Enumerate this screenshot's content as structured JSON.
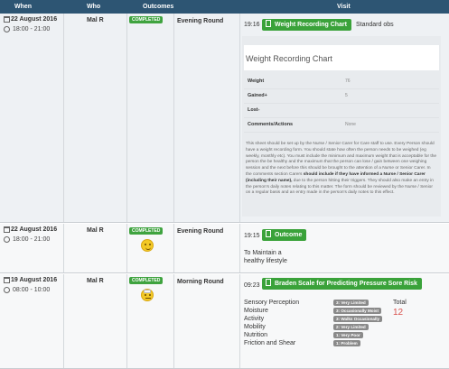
{
  "columns": {
    "when": "When",
    "who": "Who",
    "outcomes": "Outcomes",
    "visit": "Visit"
  },
  "entries": [
    {
      "date": "22 August 2016",
      "time": "18:00 - 21:00",
      "who": "Mal R",
      "status": "COMPLETED",
      "round": "Evening Round",
      "visit_time": "19:16",
      "chart_button": "Weight Recording Chart",
      "chart_note": "Standard obs",
      "sheet": {
        "title": "Weight Recording Chart",
        "rows": [
          {
            "label": "Weight",
            "value": "76"
          },
          {
            "label": "Gained+",
            "value": "5"
          },
          {
            "label": "Lost-",
            "value": ""
          },
          {
            "label": "Comments/Actions",
            "value": "None"
          }
        ],
        "note_pre": "This sheet should be set up by the Nurse / Senior Carer for Care staff to use. Every Person should have a weight recording form. You should state how often the person needs to be weighed (eg weekly, monthly etc). You must include the minimum and maximum weight that is acceptable for the person the be healthy and the maximum that the person can lose / gain between one weighing session and the next before this should be brought to the attention of a Nurse or Senior Carer. In the comments section Carers ",
        "note_bold": "should include if they have informed a Nurse / Senior Carer (including their name),",
        "note_post": " due to the person hitting their triggers. They should also make an entry in the person's daily notes relating to this matter. The form should be reviewed by the Nurse / Senior on a regular basis and an entry made in the person's daily notes to this effect."
      }
    },
    {
      "date": "22 August 2016",
      "time": "18:00 - 21:00",
      "who": "Mal R",
      "status": "COMPLETED",
      "round": "Evening Round",
      "visit_time": "19:15",
      "chart_button": "Outcome",
      "description": [
        "To Maintain a",
        "healthy lifestyle"
      ]
    },
    {
      "date": "19 August 2016",
      "time": "08:00 - 10:00",
      "who": "Mal R",
      "status": "COMPLETED",
      "round": "Morning Round",
      "visit_time": "09:23",
      "chart_button": "Braden Scale for Predicting Pressure Sore Risk",
      "braden": [
        {
          "label": "Sensory Perception",
          "score": "3: Very Limited"
        },
        {
          "label": "Moisture",
          "score": "3: Occasionally Moist"
        },
        {
          "label": "Activity",
          "score": "3: Walks Occasionally"
        },
        {
          "label": "Mobility",
          "score": "2: Very Limited"
        },
        {
          "label": "Nutrition",
          "score": "1: Very Poor"
        },
        {
          "label": "Friction and Shear",
          "score": "1: Problem"
        }
      ],
      "total_label": "Total",
      "total_value": "12"
    }
  ],
  "colors": {
    "header": "#2d5573",
    "green": "#3aa23a",
    "total_red": "#d9534f"
  }
}
